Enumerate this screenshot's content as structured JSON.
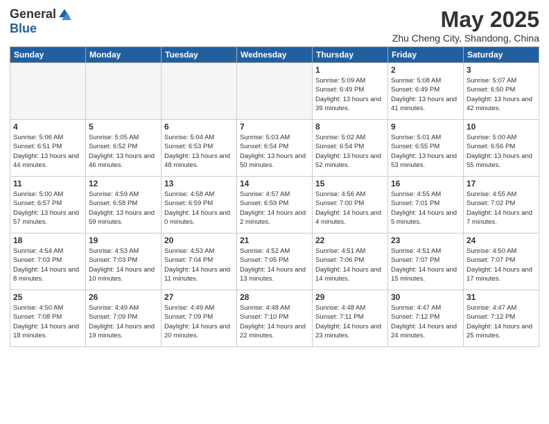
{
  "header": {
    "logo_general": "General",
    "logo_blue": "Blue",
    "month_title": "May 2025",
    "subtitle": "Zhu Cheng City, Shandong, China"
  },
  "weekdays": [
    "Sunday",
    "Monday",
    "Tuesday",
    "Wednesday",
    "Thursday",
    "Friday",
    "Saturday"
  ],
  "weeks": [
    [
      {
        "day": "",
        "empty": true
      },
      {
        "day": "",
        "empty": true
      },
      {
        "day": "",
        "empty": true
      },
      {
        "day": "",
        "empty": true
      },
      {
        "day": "1",
        "sunrise": "5:09 AM",
        "sunset": "6:49 PM",
        "daylight": "13 hours and 39 minutes."
      },
      {
        "day": "2",
        "sunrise": "5:08 AM",
        "sunset": "6:49 PM",
        "daylight": "13 hours and 41 minutes."
      },
      {
        "day": "3",
        "sunrise": "5:07 AM",
        "sunset": "6:50 PM",
        "daylight": "13 hours and 42 minutes."
      }
    ],
    [
      {
        "day": "4",
        "sunrise": "5:06 AM",
        "sunset": "6:51 PM",
        "daylight": "13 hours and 44 minutes."
      },
      {
        "day": "5",
        "sunrise": "5:05 AM",
        "sunset": "6:52 PM",
        "daylight": "13 hours and 46 minutes."
      },
      {
        "day": "6",
        "sunrise": "5:04 AM",
        "sunset": "6:53 PM",
        "daylight": "13 hours and 48 minutes."
      },
      {
        "day": "7",
        "sunrise": "5:03 AM",
        "sunset": "6:54 PM",
        "daylight": "13 hours and 50 minutes."
      },
      {
        "day": "8",
        "sunrise": "5:02 AM",
        "sunset": "6:54 PM",
        "daylight": "13 hours and 52 minutes."
      },
      {
        "day": "9",
        "sunrise": "5:01 AM",
        "sunset": "6:55 PM",
        "daylight": "13 hours and 53 minutes."
      },
      {
        "day": "10",
        "sunrise": "5:00 AM",
        "sunset": "6:56 PM",
        "daylight": "13 hours and 55 minutes."
      }
    ],
    [
      {
        "day": "11",
        "sunrise": "5:00 AM",
        "sunset": "6:57 PM",
        "daylight": "13 hours and 57 minutes."
      },
      {
        "day": "12",
        "sunrise": "4:59 AM",
        "sunset": "6:58 PM",
        "daylight": "13 hours and 59 minutes."
      },
      {
        "day": "13",
        "sunrise": "4:58 AM",
        "sunset": "6:59 PM",
        "daylight": "14 hours and 0 minutes."
      },
      {
        "day": "14",
        "sunrise": "4:57 AM",
        "sunset": "6:59 PM",
        "daylight": "14 hours and 2 minutes."
      },
      {
        "day": "15",
        "sunrise": "4:56 AM",
        "sunset": "7:00 PM",
        "daylight": "14 hours and 4 minutes."
      },
      {
        "day": "16",
        "sunrise": "4:55 AM",
        "sunset": "7:01 PM",
        "daylight": "14 hours and 5 minutes."
      },
      {
        "day": "17",
        "sunrise": "4:55 AM",
        "sunset": "7:02 PM",
        "daylight": "14 hours and 7 minutes."
      }
    ],
    [
      {
        "day": "18",
        "sunrise": "4:54 AM",
        "sunset": "7:03 PM",
        "daylight": "14 hours and 8 minutes."
      },
      {
        "day": "19",
        "sunrise": "4:53 AM",
        "sunset": "7:03 PM",
        "daylight": "14 hours and 10 minutes."
      },
      {
        "day": "20",
        "sunrise": "4:53 AM",
        "sunset": "7:04 PM",
        "daylight": "14 hours and 11 minutes."
      },
      {
        "day": "21",
        "sunrise": "4:52 AM",
        "sunset": "7:05 PM",
        "daylight": "14 hours and 13 minutes."
      },
      {
        "day": "22",
        "sunrise": "4:51 AM",
        "sunset": "7:06 PM",
        "daylight": "14 hours and 14 minutes."
      },
      {
        "day": "23",
        "sunrise": "4:51 AM",
        "sunset": "7:07 PM",
        "daylight": "14 hours and 15 minutes."
      },
      {
        "day": "24",
        "sunrise": "4:50 AM",
        "sunset": "7:07 PM",
        "daylight": "14 hours and 17 minutes."
      }
    ],
    [
      {
        "day": "25",
        "sunrise": "4:50 AM",
        "sunset": "7:08 PM",
        "daylight": "14 hours and 18 minutes."
      },
      {
        "day": "26",
        "sunrise": "4:49 AM",
        "sunset": "7:09 PM",
        "daylight": "14 hours and 19 minutes."
      },
      {
        "day": "27",
        "sunrise": "4:49 AM",
        "sunset": "7:09 PM",
        "daylight": "14 hours and 20 minutes."
      },
      {
        "day": "28",
        "sunrise": "4:48 AM",
        "sunset": "7:10 PM",
        "daylight": "14 hours and 22 minutes."
      },
      {
        "day": "29",
        "sunrise": "4:48 AM",
        "sunset": "7:11 PM",
        "daylight": "14 hours and 23 minutes."
      },
      {
        "day": "30",
        "sunrise": "4:47 AM",
        "sunset": "7:12 PM",
        "daylight": "14 hours and 24 minutes."
      },
      {
        "day": "31",
        "sunrise": "4:47 AM",
        "sunset": "7:12 PM",
        "daylight": "14 hours and 25 minutes."
      }
    ]
  ]
}
